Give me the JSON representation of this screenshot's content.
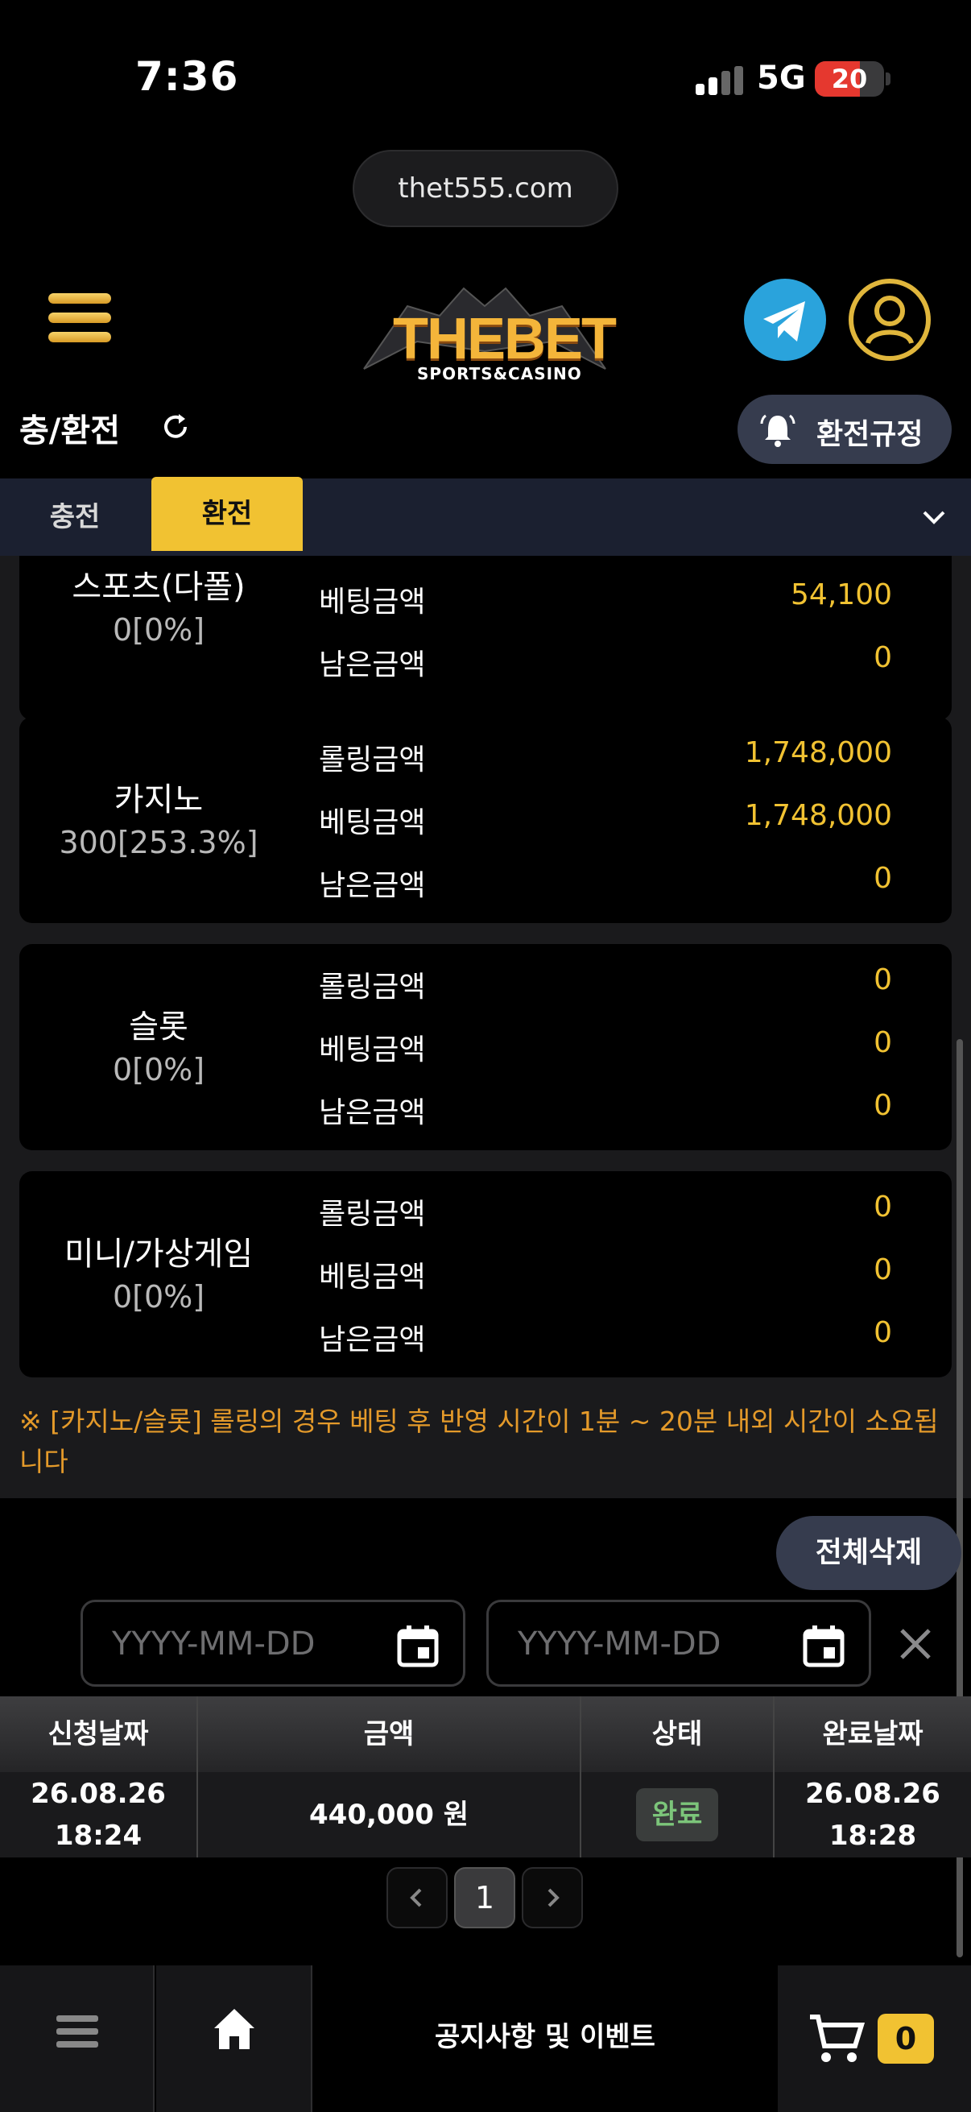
{
  "status_bar": {
    "time": "7:36",
    "network": "5G",
    "battery": "20"
  },
  "browser": {
    "url": "thet555.com"
  },
  "header": {
    "logo_main": "THEBET",
    "logo_sub": "SPORTS&CASINO"
  },
  "page": {
    "title": "충/환전",
    "rules_button": "환전규정"
  },
  "tabs": {
    "deposit": "충전",
    "withdraw": "환전",
    "active": "환전"
  },
  "row_labels": {
    "rolling": "롤링금액",
    "betting": "베팅금액",
    "remaining": "남은금액"
  },
  "cards": [
    {
      "name": "스포츠(다폴)",
      "percent": "0[0%]",
      "betting": "54,100",
      "remaining": "0"
    },
    {
      "name": "카지노",
      "percent": "300[253.3%]",
      "rolling": "1,748,000",
      "betting": "1,748,000",
      "remaining": "0"
    },
    {
      "name": "슬롯",
      "percent": "0[0%]",
      "rolling": "0",
      "betting": "0",
      "remaining": "0"
    },
    {
      "name": "미니/가상게임",
      "percent": "0[0%]",
      "rolling": "0",
      "betting": "0",
      "remaining": "0"
    }
  ],
  "notice": "※ [카지노/슬롯] 롤링의 경우 베팅 후 반영 시간이 1분 ~ 20분 내외 시간이 소요됩니다",
  "list": {
    "delete_all": "전체삭제",
    "date_placeholder": "YYYY-MM-DD",
    "columns": [
      "신청날짜",
      "금액",
      "상태",
      "완료날짜"
    ],
    "rows": [
      {
        "request_date": "26.08.26",
        "request_time": "18:24",
        "amount": "440,000 원",
        "status": "완료",
        "complete_date": "26.08.26",
        "complete_time": "18:28"
      }
    ]
  },
  "pagination": {
    "current": "1"
  },
  "bottom_nav": {
    "notice": "공지사항 및 이벤트",
    "cart_count": "0"
  },
  "colors": {
    "accent": "#f1c232",
    "value": "#f1c232",
    "notice": "#e49a2a",
    "status_done": "#7cc57a",
    "tab_bar": "#1b2030"
  }
}
